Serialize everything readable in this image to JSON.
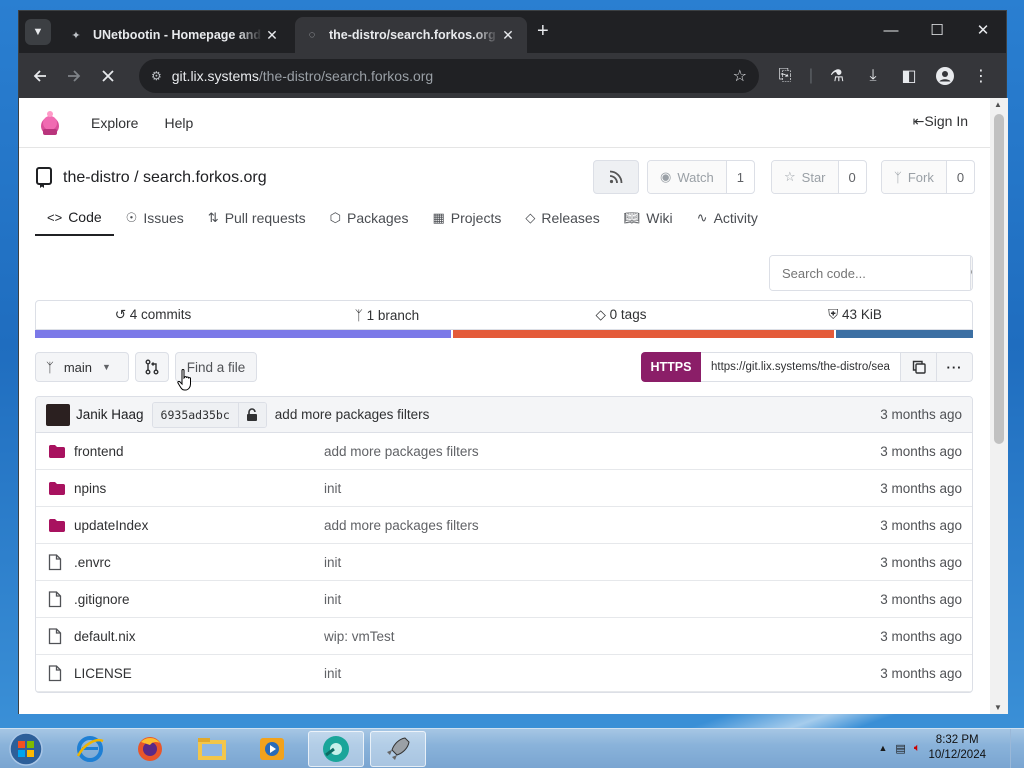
{
  "browser": {
    "tabs": [
      {
        "title": "UNetbootin - Homepage and Downloads",
        "active": false
      },
      {
        "title": "the-distro/search.forkos.org - Forgejo",
        "active": true
      }
    ],
    "url_domain": "git.lix.systems",
    "url_path": "/the-distro/search.forkos.org"
  },
  "site": {
    "nav": {
      "explore": "Explore",
      "help": "Help",
      "sign_in": "Sign In"
    }
  },
  "repo": {
    "title": "the-distro / search.forkos.org",
    "watch_label": "Watch",
    "watch_count": "1",
    "star_label": "Star",
    "star_count": "0",
    "fork_label": "Fork",
    "fork_count": "0",
    "tabs": [
      "Code",
      "Issues",
      "Pull requests",
      "Packages",
      "Projects",
      "Releases",
      "Wiki",
      "Activity"
    ],
    "search_placeholder": "Search code...",
    "stats": {
      "commits": "4 commits",
      "branches": "1 branch",
      "tags": "0 tags",
      "size": "43 KiB"
    },
    "language_colors": [
      "#7b79e8",
      "#e45b3a",
      "#3c6fa3"
    ],
    "language_shares": [
      0.445,
      0.408,
      0.147
    ],
    "branch": "main",
    "find_file": "Find a file",
    "clone_protocol": "HTTPS",
    "clone_url": "https://git.lix.systems/the-distro/search.forkos.org.git",
    "latest_commit": {
      "author": "Janik Haag",
      "sha": "6935ad35bc",
      "message": "add more packages filters",
      "age": "3 months ago"
    },
    "files": [
      {
        "name": "frontend",
        "type": "dir",
        "message": "add more packages filters",
        "age": "3 months ago"
      },
      {
        "name": "npins",
        "type": "dir",
        "message": "init",
        "age": "3 months ago"
      },
      {
        "name": "updateIndex",
        "type": "dir",
        "message": "add more packages filters",
        "age": "3 months ago"
      },
      {
        "name": ".envrc",
        "type": "file",
        "message": "init",
        "age": "3 months ago"
      },
      {
        "name": ".gitignore",
        "type": "file",
        "message": "init",
        "age": "3 months ago"
      },
      {
        "name": "default.nix",
        "type": "file",
        "message": "wip: vmTest",
        "age": "3 months ago"
      },
      {
        "name": "LICENSE",
        "type": "file",
        "message": "init",
        "age": "3 months ago"
      }
    ]
  },
  "taskbar": {
    "time": "8:32 PM",
    "date": "10/12/2024"
  }
}
